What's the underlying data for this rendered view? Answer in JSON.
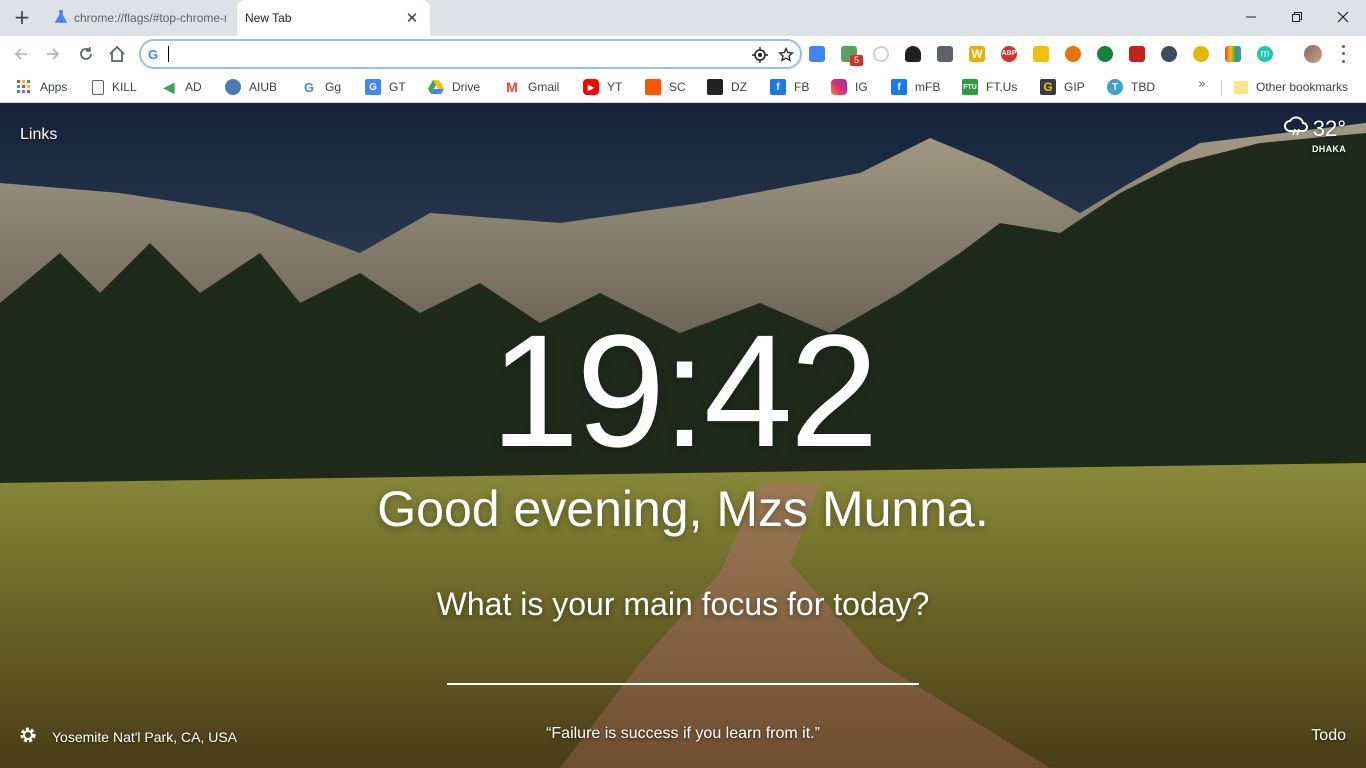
{
  "tabs": [
    {
      "title": "chrome://flags/#top-chrome-md",
      "active": false
    },
    {
      "title": "New Tab",
      "active": true
    }
  ],
  "omnibox": {
    "value": "",
    "placeholder": ""
  },
  "extensions": [
    {
      "name": "google-translate-icon",
      "color": "#4285f4"
    },
    {
      "name": "ext-grid-icon",
      "color": "#5f9e5f",
      "badge": "5"
    },
    {
      "name": "refresh-ext-icon",
      "color": "#bdbdbd"
    },
    {
      "name": "spy-icon",
      "color": "#202124"
    },
    {
      "name": "download-icon",
      "color": "#5f6368"
    },
    {
      "name": "w-icon",
      "color": "#f2a900"
    },
    {
      "name": "abp-icon",
      "color": "#d93025"
    },
    {
      "name": "dots-icon",
      "color": "#f2c200"
    },
    {
      "name": "chrome-cast-icon",
      "color": "#e8710a"
    },
    {
      "name": "globe-icon",
      "color": "#188038"
    },
    {
      "name": "pen-icon",
      "color": "#c5221f"
    },
    {
      "name": "steam-icon",
      "color": "#3d4a60"
    },
    {
      "name": "coin-icon",
      "color": "#e5b800"
    },
    {
      "name": "color-palette-icon",
      "color": "#f29900"
    },
    {
      "name": "m-icon",
      "color": "#1ec6b6"
    }
  ],
  "bookmarks": [
    {
      "label": "Apps",
      "icon": "apps-icon",
      "color": "#ea4335"
    },
    {
      "label": "KILL",
      "icon": "page-icon",
      "color": "#ffffff"
    },
    {
      "label": "AD",
      "icon": "arrow-icon",
      "color": "#34a853"
    },
    {
      "label": "AIUB",
      "icon": "aiub-icon",
      "color": "#4a79b8"
    },
    {
      "label": "Gg",
      "icon": "google-icon",
      "color": "#4285f4"
    },
    {
      "label": "GT",
      "icon": "translate-icon",
      "color": "#4285f4"
    },
    {
      "label": "Drive",
      "icon": "drive-icon",
      "color": "#fbbc04"
    },
    {
      "label": "Gmail",
      "icon": "gmail-icon",
      "color": "#ea4335"
    },
    {
      "label": "YT",
      "icon": "youtube-icon",
      "color": "#ff0000"
    },
    {
      "label": "SC",
      "icon": "soundcloud-icon",
      "color": "#ff5500"
    },
    {
      "label": "DZ",
      "icon": "deezer-icon",
      "color": "#222222"
    },
    {
      "label": "FB",
      "icon": "facebook-icon",
      "color": "#1877f2"
    },
    {
      "label": "IG",
      "icon": "instagram-icon",
      "color": "#c13584"
    },
    {
      "label": "mFB",
      "icon": "facebook-icon",
      "color": "#1877f2"
    },
    {
      "label": "FT.Us",
      "icon": "ftu-icon",
      "color": "#2e9c3a"
    },
    {
      "label": "GIP",
      "icon": "gip-icon",
      "color": "#f2c200"
    },
    {
      "label": "TBD",
      "icon": "tbd-icon",
      "color": "#3aa0d8"
    }
  ],
  "bookmarks_overflow": "»",
  "other_bookmarks": "Other bookmarks",
  "momentum": {
    "links": "Links",
    "weather": {
      "temp": "32°",
      "city": "DHAKA"
    },
    "clock": "19:42",
    "greeting": "Good evening, Mzs Munna.",
    "focus_question": "What is your main focus for today?",
    "location": "Yosemite Nat'l Park, CA, USA",
    "quote": "“Failure is success if you learn from it.”",
    "todo": "Todo"
  }
}
